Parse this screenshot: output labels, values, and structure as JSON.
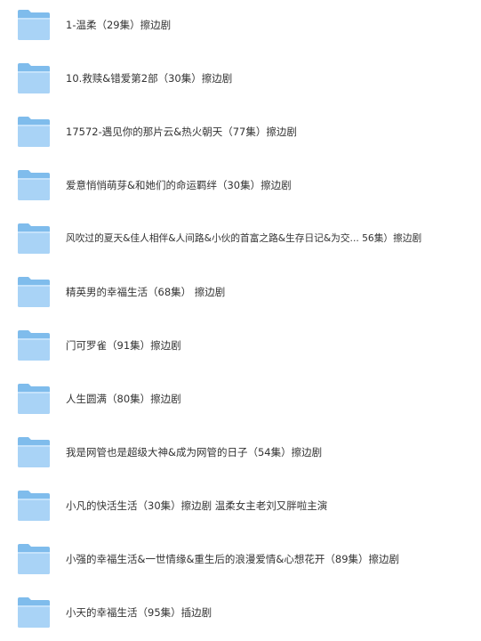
{
  "folders": [
    {
      "name": "1-温柔（29集）擦边剧",
      "icon": "folder-icon"
    },
    {
      "name": "10.救赎&错爱第2部（30集）擦边剧",
      "icon": "folder-icon"
    },
    {
      "name": "17572-遇见你的那片云&热火朝天（77集）擦边剧",
      "icon": "folder-icon"
    },
    {
      "name": "爱意悄悄萌芽&和她们的命运羁绊（30集）擦边剧",
      "icon": "folder-icon"
    },
    {
      "name": "风吹过的夏天&佳人相伴&人间路&小伙的首富之路&生存日记&为交...  56集）擦边剧",
      "icon": "folder-icon"
    },
    {
      "name": "精英男的幸福生活（68集） 擦边剧",
      "icon": "folder-icon"
    },
    {
      "name": "门可罗雀（91集）擦边剧",
      "icon": "folder-icon"
    },
    {
      "name": "人生圆满（80集）擦边剧",
      "icon": "folder-icon"
    },
    {
      "name": "我是网管也是超级大神&成为网管的日子（54集）擦边剧",
      "icon": "folder-icon"
    },
    {
      "name": "小凡的快活生活（30集）擦边剧 温柔女主老刘又胖啦主演",
      "icon": "folder-icon"
    },
    {
      "name": "小强的幸福生活&一世情缘&重生后的浪漫爱情&心想花开（89集）擦边剧",
      "icon": "folder-icon"
    },
    {
      "name": "小天的幸福生活（95集）插边剧",
      "icon": "folder-icon"
    }
  ],
  "colors": {
    "folder_back": "#7fbcec",
    "folder_front": "#a9d3f6",
    "folder_front_light": "#c4e2fb",
    "text": "#333333"
  }
}
